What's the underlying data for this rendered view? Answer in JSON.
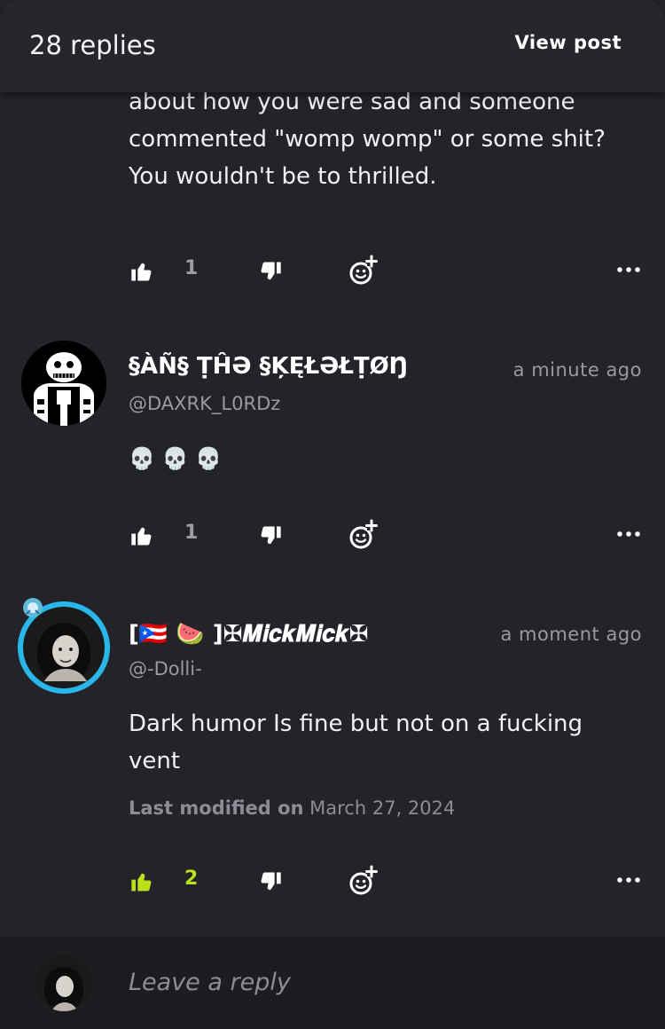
{
  "header": {
    "reply_count": "28 replies",
    "view_post": "View post"
  },
  "prev_comment": {
    "lines": [
      "about how you were sad and someone",
      "commented \"womp womp\" or some shit?",
      "You wouldn't be to thrilled."
    ],
    "likes": "1"
  },
  "comments": [
    {
      "name": "§ÀÑ§ ṬĤƏ §ĶĘŁƏŁṬØŊ",
      "handle": "@DAXRK_L0RDz",
      "time": "a minute ago",
      "text": "💀 💀 💀",
      "likes": "1"
    },
    {
      "name": "[🇵🇷 🍉 ]✠𝑴𝒊𝒄𝒌𝑴𝒊𝒄𝒌✠",
      "handle": "@-Dolli-",
      "time": "a moment ago",
      "text_lines": [
        "Dark humor Is fine but not on a fucking",
        "vent"
      ],
      "modified_label": "Last modified on",
      "modified_date": "March 27, 2024",
      "likes": "2"
    }
  ],
  "reply_input": {
    "placeholder": "Leave a reply"
  },
  "colors": {
    "background": "#24232a",
    "accent_like": "#b9e019",
    "muted": "#9a99a3"
  },
  "icons": [
    "thumbs-up-icon",
    "thumbs-down-icon",
    "add-reaction-icon",
    "more-icon"
  ]
}
